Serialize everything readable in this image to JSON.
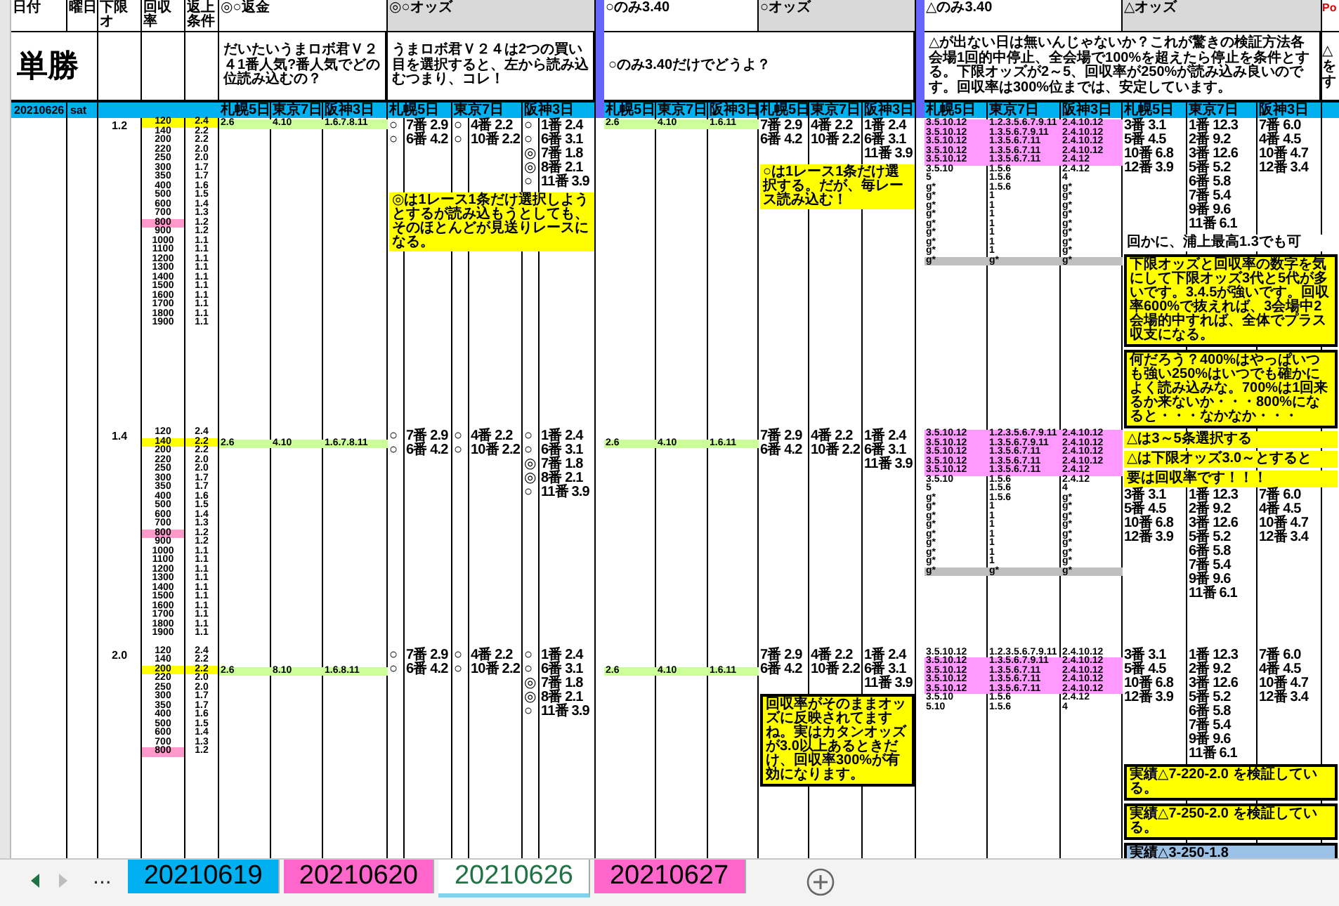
{
  "sheet_title": "単勝",
  "left_headers": [
    "日付",
    "曜日",
    "下限オ",
    "回収率",
    "返上条件"
  ],
  "date": "20210626",
  "weekday": "sat",
  "groups": [
    {
      "title": "◎○返金",
      "shaded": false,
      "paired": false,
      "note": "だいたいうまロボ君Ｖ２４1番人気?番人気でどの位読み込むの？",
      "venues": [
        "札幌5日",
        "東京7日",
        "阪神3日"
      ]
    },
    {
      "title": "◎○オッズ",
      "shaded": true,
      "paired": true,
      "note": "うまロボ君Ｖ２４は2つの買い目を選択すると、左から読み込むつまり、コレ！",
      "venues": [
        "札幌5日",
        "東京7日",
        "阪神3日"
      ]
    },
    {
      "title": "○のみ3.40",
      "shaded": false,
      "paired": false,
      "note": "○のみ3.40だけでどうよ？",
      "venues": [
        "札幌5日",
        "東京7日",
        "阪神3日"
      ]
    },
    {
      "title": "○オッズ",
      "shaded": true,
      "paired": false,
      "venues": [
        "札幌5日",
        "東京7日",
        "阪神3日"
      ]
    },
    {
      "title": "△のみ3.40",
      "shaded": false,
      "paired": false,
      "note": "△が出ない日は無いんじゃないか？これが驚きの検証方法各会場1回的中停止、全会場で100%を超えたら停止を条件とする。下限オッズが2～5、回収率が250%が読み込み良いのです。回収率は300%位までは、安定しています。",
      "venues": [
        "札幌5日",
        "東京7日",
        "阪神3日"
      ]
    },
    {
      "title": "△オッズ",
      "shaded": true,
      "paired": false,
      "venues": [
        "札幌5日",
        "東京7日",
        "阪神3日"
      ]
    }
  ],
  "po": {
    "title": "Po",
    "note_lines": [
      "△",
      "を",
      "す"
    ]
  },
  "blocks": [
    {
      "lower_odds": "1.2",
      "odds": [
        {
          "odds": "120",
          "rate": "2.4",
          "selected": true,
          "flagged": false
        },
        {
          "odds": "140",
          "rate": "2.2",
          "selected": false,
          "flagged": false
        },
        {
          "odds": "200",
          "rate": "2.2",
          "selected": false,
          "flagged": false
        },
        {
          "odds": "220",
          "rate": "2.0",
          "selected": false,
          "flagged": false
        },
        {
          "odds": "250",
          "rate": "2.0",
          "selected": false,
          "flagged": false
        },
        {
          "odds": "300",
          "rate": "1.7",
          "selected": false,
          "flagged": false
        },
        {
          "odds": "350",
          "rate": "1.7",
          "selected": false,
          "flagged": false
        },
        {
          "odds": "400",
          "rate": "1.6",
          "selected": false,
          "flagged": false
        },
        {
          "odds": "500",
          "rate": "1.5",
          "selected": false,
          "flagged": false
        },
        {
          "odds": "600",
          "rate": "1.4",
          "selected": false,
          "flagged": false
        },
        {
          "odds": "700",
          "rate": "1.3",
          "selected": false,
          "flagged": false
        },
        {
          "odds": "800",
          "rate": "1.2",
          "selected": false,
          "flagged": true
        },
        {
          "odds": "900",
          "rate": "1.2",
          "selected": false,
          "flagged": false
        },
        {
          "odds": "1000",
          "rate": "1.1",
          "selected": false,
          "flagged": false
        },
        {
          "odds": "1100",
          "rate": "1.1",
          "selected": false,
          "flagged": false
        },
        {
          "odds": "1200",
          "rate": "1.1",
          "selected": false,
          "flagged": false
        },
        {
          "odds": "1300",
          "rate": "1.1",
          "selected": false,
          "flagged": false
        },
        {
          "odds": "1400",
          "rate": "1.1",
          "selected": false,
          "flagged": false
        },
        {
          "odds": "1500",
          "rate": "1.1",
          "selected": false,
          "flagged": false
        },
        {
          "odds": "1600",
          "rate": "1.1",
          "selected": false,
          "flagged": false
        },
        {
          "odds": "1700",
          "rate": "1.1",
          "selected": false,
          "flagged": false
        },
        {
          "odds": "1800",
          "rate": "1.1",
          "selected": false,
          "flagged": false
        },
        {
          "odds": "1900",
          "rate": "1.1",
          "selected": false,
          "flagged": false
        }
      ],
      "groups": [
        [
          {
            "kind": "selection",
            "columns": [
              [
                "2.6"
              ],
              [
                "4.10"
              ],
              [
                "1.6.7.8.11"
              ]
            ]
          }
        ],
        [
          {
            "kind": "lines",
            "columns": [
              [
                "○",
                "○"
              ],
              [
                "7番 2.9",
                "6番 4.2"
              ],
              [
                "○",
                "○"
              ],
              [
                "4番 2.2",
                "10番 2.2"
              ],
              [
                "○",
                "○",
                "◎",
                "◎",
                "○"
              ],
              [
                "1番 2.4",
                "6番 3.1",
                "7番 1.8",
                "8番 2.1",
                "11番 3.9"
              ]
            ]
          },
          {
            "kind": "highlight_note",
            "text": "◎は1レース1条だけ選択しようとするが読み込もうとしても、そのほとんどが見送りレースになる。"
          }
        ],
        [
          {
            "kind": "selection",
            "columns": [
              [
                "2.6"
              ],
              [
                "4.10"
              ],
              [
                "1.6.11"
              ]
            ]
          }
        ],
        [
          {
            "kind": "lines",
            "columns": [
              [
                "7番 2.9",
                "6番 4.2"
              ],
              [
                "4番 2.2",
                "10番 2.2"
              ],
              [
                "1番 2.4",
                "6番 3.1",
                "11番 3.9"
              ]
            ]
          },
          {
            "kind": "highlight_note",
            "text": "○は1レース1条だけ選択する。だが、毎レース読み込む！"
          }
        ],
        [
          {
            "kind": "marked_rows",
            "rows": [
              {
                "cells": [
                  "3.5.10.12",
                  "1.2.3.5.6.7.9.11",
                  "2.4.10.12"
                ],
                "marked": true,
                "shaded": false
              },
              {
                "cells": [
                  "3.5.10.12",
                  "1.3.5.6.7.9.11",
                  "2.4.10.12"
                ],
                "marked": true,
                "shaded": false
              },
              {
                "cells": [
                  "3.5.10.12",
                  "1.3.5.6.7.11",
                  "2.4.10.12"
                ],
                "marked": true,
                "shaded": false
              },
              {
                "cells": [
                  "3.5.10.12",
                  "1.3.5.6.7.11",
                  "2.4.10.12"
                ],
                "marked": true,
                "shaded": false
              },
              {
                "cells": [
                  "3.5.10.12",
                  "1.3.5.6.7.11",
                  "2.4.12"
                ],
                "marked": true,
                "shaded": false
              },
              {
                "cells": [
                  "3.5.10",
                  "1.5.6",
                  "2.4.12"
                ],
                "marked": false,
                "shaded": false
              },
              {
                "cells": [
                  "5",
                  "1.5.6",
                  "4"
                ],
                "marked": false,
                "shaded": false
              },
              {
                "cells": [
                  "g*",
                  "1.5.6",
                  "g*"
                ],
                "marked": false,
                "shaded": false
              },
              {
                "cells": [
                  "g*",
                  "1",
                  "g*"
                ],
                "marked": false,
                "shaded": false
              },
              {
                "cells": [
                  "g*",
                  "1",
                  "g*"
                ],
                "marked": false,
                "shaded": false
              },
              {
                "cells": [
                  "g*",
                  "1",
                  "g*"
                ],
                "marked": false,
                "shaded": false
              },
              {
                "cells": [
                  "g*",
                  "1",
                  "g*"
                ],
                "marked": false,
                "shaded": false
              },
              {
                "cells": [
                  "g*",
                  "1",
                  "g*"
                ],
                "marked": false,
                "shaded": false
              },
              {
                "cells": [
                  "g*",
                  "1",
                  "g*"
                ],
                "marked": false,
                "shaded": false
              },
              {
                "cells": [
                  "g*",
                  "1",
                  "g*"
                ],
                "marked": false,
                "shaded": false
              },
              {
                "cells": [
                  "g*",
                  "g*",
                  "g*"
                ],
                "marked": false,
                "shaded": true
              }
            ]
          }
        ],
        [
          {
            "kind": "lines",
            "columns": [
              [
                "3番 3.1",
                "5番 4.5",
                "10番 6.8",
                "12番 3.9"
              ],
              [
                "1番 12.3",
                "2番 9.2",
                "3番 12.6",
                "5番 5.2",
                "6番 5.8",
                "7番 5.4",
                "9番 9.6",
                "11番 6.1"
              ],
              [
                "7番 6.0",
                "4番 4.5",
                "10番 4.7",
                "12番 3.4"
              ]
            ]
          },
          {
            "kind": "comment",
            "text": "回かに、浦上最高1.3でも可"
          },
          {
            "kind": "boxed_note",
            "text": "下限オッズと回収率の数字を気にして下限オッズ3代と5代が多いです。3.4.5が強いです。回収率600%で抜えれば、3会場中2会場的中すれば、全体でプラス収支になる。"
          },
          {
            "kind": "boxed_note",
            "text": "何だろう？400%はやっぱいつも強い250%はいつでも確かによく読み込みな。700%は1回来るか来ないか・・・800%になると・・・なかなか・・・"
          }
        ]
      ]
    },
    {
      "lower_odds": "1.4",
      "odds": [
        {
          "odds": "120",
          "rate": "2.4",
          "selected": false,
          "flagged": false
        },
        {
          "odds": "140",
          "rate": "2.2",
          "selected": true,
          "flagged": false
        },
        {
          "odds": "200",
          "rate": "2.2",
          "selected": false,
          "flagged": false
        },
        {
          "odds": "220",
          "rate": "2.0",
          "selected": false,
          "flagged": false
        },
        {
          "odds": "250",
          "rate": "2.0",
          "selected": false,
          "flagged": false
        },
        {
          "odds": "300",
          "rate": "1.7",
          "selected": false,
          "flagged": false
        },
        {
          "odds": "350",
          "rate": "1.7",
          "selected": false,
          "flagged": false
        },
        {
          "odds": "400",
          "rate": "1.6",
          "selected": false,
          "flagged": false
        },
        {
          "odds": "500",
          "rate": "1.5",
          "selected": false,
          "flagged": false
        },
        {
          "odds": "600",
          "rate": "1.4",
          "selected": false,
          "flagged": false
        },
        {
          "odds": "700",
          "rate": "1.3",
          "selected": false,
          "flagged": false
        },
        {
          "odds": "800",
          "rate": "1.2",
          "selected": false,
          "flagged": true
        },
        {
          "odds": "900",
          "rate": "1.2",
          "selected": false,
          "flagged": false
        },
        {
          "odds": "1000",
          "rate": "1.1",
          "selected": false,
          "flagged": false
        },
        {
          "odds": "1100",
          "rate": "1.1",
          "selected": false,
          "flagged": false
        },
        {
          "odds": "1200",
          "rate": "1.1",
          "selected": false,
          "flagged": false
        },
        {
          "odds": "1300",
          "rate": "1.1",
          "selected": false,
          "flagged": false
        },
        {
          "odds": "1400",
          "rate": "1.1",
          "selected": false,
          "flagged": false
        },
        {
          "odds": "1500",
          "rate": "1.1",
          "selected": false,
          "flagged": false
        },
        {
          "odds": "1600",
          "rate": "1.1",
          "selected": false,
          "flagged": false
        },
        {
          "odds": "1700",
          "rate": "1.1",
          "selected": false,
          "flagged": false
        },
        {
          "odds": "1800",
          "rate": "1.1",
          "selected": false,
          "flagged": false
        },
        {
          "odds": "1900",
          "rate": "1.1",
          "selected": false,
          "flagged": false
        }
      ],
      "groups": [
        [
          {
            "kind": "selection",
            "columns": [
              [
                "2.6"
              ],
              [
                "4.10"
              ],
              [
                "1.6.7.8.11"
              ]
            ]
          }
        ],
        [
          {
            "kind": "lines",
            "columns": [
              [
                "○",
                "○"
              ],
              [
                "7番 2.9",
                "6番 4.2"
              ],
              [
                "○",
                "○"
              ],
              [
                "4番 2.2",
                "10番 2.2"
              ],
              [
                "○",
                "○",
                "◎",
                "◎",
                "○"
              ],
              [
                "1番 2.4",
                "6番 3.1",
                "7番 1.8",
                "8番 2.1",
                "11番 3.9"
              ]
            ]
          }
        ],
        [
          {
            "kind": "selection",
            "columns": [
              [
                "2.6"
              ],
              [
                "4.10"
              ],
              [
                "1.6.11"
              ]
            ]
          }
        ],
        [
          {
            "kind": "lines",
            "columns": [
              [
                "7番 2.9",
                "6番 4.2"
              ],
              [
                "4番 2.2",
                "10番 2.2"
              ],
              [
                "1番 2.4",
                "6番 3.1",
                "11番 3.9"
              ]
            ]
          }
        ],
        [
          {
            "kind": "marked_rows",
            "rows": [
              {
                "cells": [
                  "3.5.10.12",
                  "1.2.3.5.6.7.9.11",
                  "2.4.10.12"
                ],
                "marked": true,
                "shaded": false
              },
              {
                "cells": [
                  "3.5.10.12",
                  "1.3.5.6.7.9.11",
                  "2.4.10.12"
                ],
                "marked": true,
                "shaded": false
              },
              {
                "cells": [
                  "3.5.10.12",
                  "1.3.5.6.7.11",
                  "2.4.10.12"
                ],
                "marked": true,
                "shaded": false
              },
              {
                "cells": [
                  "3.5.10.12",
                  "1.3.5.6.7.11",
                  "2.4.10.12"
                ],
                "marked": true,
                "shaded": false
              },
              {
                "cells": [
                  "3.5.10.12",
                  "1.3.5.6.7.11",
                  "2.4.12"
                ],
                "marked": true,
                "shaded": false
              },
              {
                "cells": [
                  "3.5.10",
                  "1.5.6",
                  "2.4.12"
                ],
                "marked": false,
                "shaded": false
              },
              {
                "cells": [
                  "5",
                  "1.5.6",
                  "4"
                ],
                "marked": false,
                "shaded": false
              },
              {
                "cells": [
                  "g*",
                  "1.5.6",
                  "g*"
                ],
                "marked": false,
                "shaded": false
              },
              {
                "cells": [
                  "g*",
                  "1",
                  "g*"
                ],
                "marked": false,
                "shaded": false
              },
              {
                "cells": [
                  "g*",
                  "1",
                  "g*"
                ],
                "marked": false,
                "shaded": false
              },
              {
                "cells": [
                  "g*",
                  "1",
                  "g*"
                ],
                "marked": false,
                "shaded": false
              },
              {
                "cells": [
                  "g*",
                  "1",
                  "g*"
                ],
                "marked": false,
                "shaded": false
              },
              {
                "cells": [
                  "g*",
                  "1",
                  "g*"
                ],
                "marked": false,
                "shaded": false
              },
              {
                "cells": [
                  "g*",
                  "1",
                  "g*"
                ],
                "marked": false,
                "shaded": false
              },
              {
                "cells": [
                  "g*",
                  "1",
                  "g*"
                ],
                "marked": false,
                "shaded": false
              },
              {
                "cells": [
                  "g*",
                  "g*",
                  "g*"
                ],
                "marked": false,
                "shaded": true
              }
            ]
          }
        ],
        [
          {
            "kind": "highlight_note",
            "text": "△は3～5条選択する"
          },
          {
            "kind": "highlight_note",
            "text": "△は下限オッズ3.0～とすると"
          },
          {
            "kind": "highlight_note",
            "text": "要は回収率です！！！"
          },
          {
            "kind": "lines",
            "columns": [
              [
                "3番 3.1",
                "5番 4.5",
                "10番 6.8",
                "12番 3.9"
              ],
              [
                "1番 12.3",
                "2番 9.2",
                "3番 12.6",
                "5番 5.2",
                "6番 5.8",
                "7番 5.4",
                "9番 9.6",
                "11番 6.1"
              ],
              [
                "7番 6.0",
                "4番 4.5",
                "10番 4.7",
                "12番 3.4"
              ]
            ]
          }
        ]
      ]
    },
    {
      "lower_odds": "2.0",
      "odds": [
        {
          "odds": "120",
          "rate": "2.4",
          "selected": false,
          "flagged": false
        },
        {
          "odds": "140",
          "rate": "2.2",
          "selected": false,
          "flagged": false
        },
        {
          "odds": "200",
          "rate": "2.2",
          "selected": true,
          "flagged": false
        },
        {
          "odds": "220",
          "rate": "2.0",
          "selected": false,
          "flagged": false
        },
        {
          "odds": "250",
          "rate": "2.0",
          "selected": false,
          "flagged": false
        },
        {
          "odds": "300",
          "rate": "1.7",
          "selected": false,
          "flagged": false
        },
        {
          "odds": "350",
          "rate": "1.7",
          "selected": false,
          "flagged": false
        },
        {
          "odds": "400",
          "rate": "1.6",
          "selected": false,
          "flagged": false
        },
        {
          "odds": "500",
          "rate": "1.5",
          "selected": false,
          "flagged": false
        },
        {
          "odds": "600",
          "rate": "1.4",
          "selected": false,
          "flagged": false
        },
        {
          "odds": "700",
          "rate": "1.3",
          "selected": false,
          "flagged": false
        },
        {
          "odds": "800",
          "rate": "1.2",
          "selected": false,
          "flagged": true
        }
      ],
      "groups": [
        [
          {
            "kind": "selection",
            "columns": [
              [
                "2.6"
              ],
              [
                "8.10"
              ],
              [
                "1.6.8.11"
              ]
            ]
          }
        ],
        [
          {
            "kind": "lines",
            "columns": [
              [
                "○",
                "○"
              ],
              [
                "7番 2.9",
                "6番 4.2"
              ],
              [
                "○",
                "○"
              ],
              [
                "4番 2.2",
                "10番 2.2"
              ],
              [
                "○",
                "○",
                "◎",
                "◎",
                "○"
              ],
              [
                "1番 2.4",
                "6番 3.1",
                "7番 1.8",
                "8番 2.1",
                "11番 3.9"
              ]
            ]
          }
        ],
        [
          {
            "kind": "selection",
            "columns": [
              [
                "2.6"
              ],
              [
                "4.10"
              ],
              [
                "1.6.11"
              ]
            ]
          }
        ],
        [
          {
            "kind": "lines",
            "columns": [
              [
                "7番 2.9",
                "6番 4.2"
              ],
              [
                "4番 2.2",
                "10番 2.2"
              ],
              [
                "1番 2.4",
                "6番 3.1",
                "11番 3.9"
              ]
            ]
          },
          {
            "kind": "boxed_note",
            "text": "回収率がそのままオッズに反映されてますね。実はカタンオッズが3.0以上あるときだけ、回収率300%が有効になります。"
          }
        ],
        [
          {
            "kind": "marked_rows",
            "rows": [
              {
                "cells": [
                  "3.5.10.12",
                  "1.2.3.5.6.7.9.11",
                  "2.4.10.12"
                ],
                "marked": false,
                "shaded": false
              },
              {
                "cells": [
                  "3.5.10.12",
                  "1.3.5.6.7.9.11",
                  "2.4.10.12"
                ],
                "marked": true,
                "shaded": false
              },
              {
                "cells": [
                  "3.5.10.12",
                  "1.3.5.6.7.11",
                  "2.4.10.12"
                ],
                "marked": true,
                "shaded": false
              },
              {
                "cells": [
                  "3.5.10.12",
                  "1.3.5.6.7.11",
                  "2.4.10.12"
                ],
                "marked": true,
                "shaded": false
              },
              {
                "cells": [
                  "3.5.10.12",
                  "1.3.5.6.7.11",
                  "2.4.10.12"
                ],
                "marked": true,
                "shaded": false
              },
              {
                "cells": [
                  "3.5.10",
                  "1.5.6",
                  "2.4.12"
                ],
                "marked": false,
                "shaded": false
              },
              {
                "cells": [
                  "5.10",
                  "1.5.6",
                  "4"
                ],
                "marked": false,
                "shaded": false
              }
            ]
          }
        ],
        [
          {
            "kind": "lines",
            "columns": [
              [
                "3番 3.1",
                "5番 4.5",
                "10番 6.8",
                "12番 3.9"
              ],
              [
                "1番 12.3",
                "2番 9.2",
                "3番 12.6",
                "5番 5.2",
                "6番 5.8",
                "7番 5.4",
                "9番 9.6",
                "11番 6.1"
              ],
              [
                "7番 6.0",
                "4番 4.5",
                "10番 4.7",
                "12番 3.4"
              ]
            ]
          },
          {
            "kind": "boxed_note",
            "text": "実績△7-220-2.0 を検証している。"
          },
          {
            "kind": "boxed_note",
            "text": "実績△7-250-2.0 を検証している。"
          },
          {
            "kind": "blue_note",
            "text": "実績△3-250-1.8"
          }
        ]
      ]
    }
  ],
  "sheet_tabs": [
    {
      "label": "20210619",
      "color": "#00b0f0",
      "selected": false
    },
    {
      "label": "20210620",
      "color": "#ff66cc",
      "selected": false
    },
    {
      "label": "20210626",
      "color": "#7fd3ec",
      "selected": true
    },
    {
      "label": "20210627",
      "color": "#ff66cc",
      "selected": false
    }
  ],
  "tab_overflow": "..."
}
